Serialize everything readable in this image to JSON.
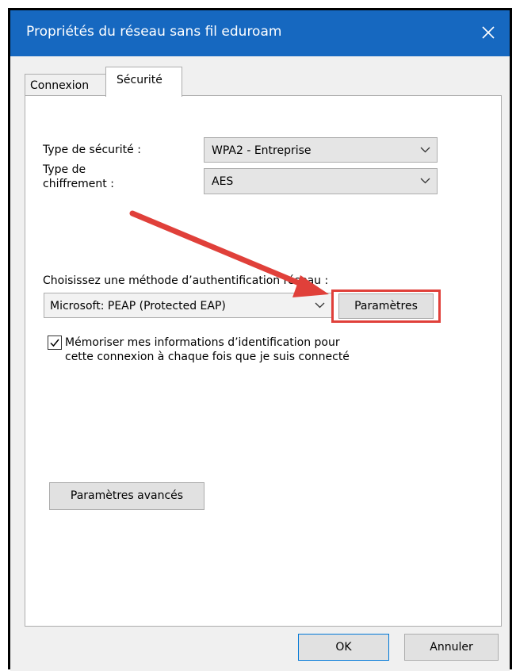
{
  "window": {
    "title": "Propriétés du réseau sans fil eduroam",
    "close_icon": "close-icon"
  },
  "tabs": [
    {
      "label": "Connexion",
      "selected": false
    },
    {
      "label": "Sécurité",
      "selected": true
    }
  ],
  "security": {
    "type_label": "Type de sécurité :",
    "type_value": "WPA2 - Entreprise",
    "encryption_label_line1": "Type de",
    "encryption_label_line2": "chiffrement :",
    "encryption_value": "AES"
  },
  "auth": {
    "method_label": "Choisissez une méthode d’authentification réseau :",
    "method_value": "Microsoft: PEAP (Protected EAP)",
    "settings_button": "Paramètres",
    "remember_checked": true,
    "remember_line1": "Mémoriser mes informations d’identification pour",
    "remember_line2": "cette connexion à chaque fois que je suis connecté"
  },
  "advanced_button": "Paramètres avancés",
  "footer": {
    "ok": "OK",
    "cancel": "Annuler"
  },
  "annotation": {
    "color": "#e0403a"
  }
}
